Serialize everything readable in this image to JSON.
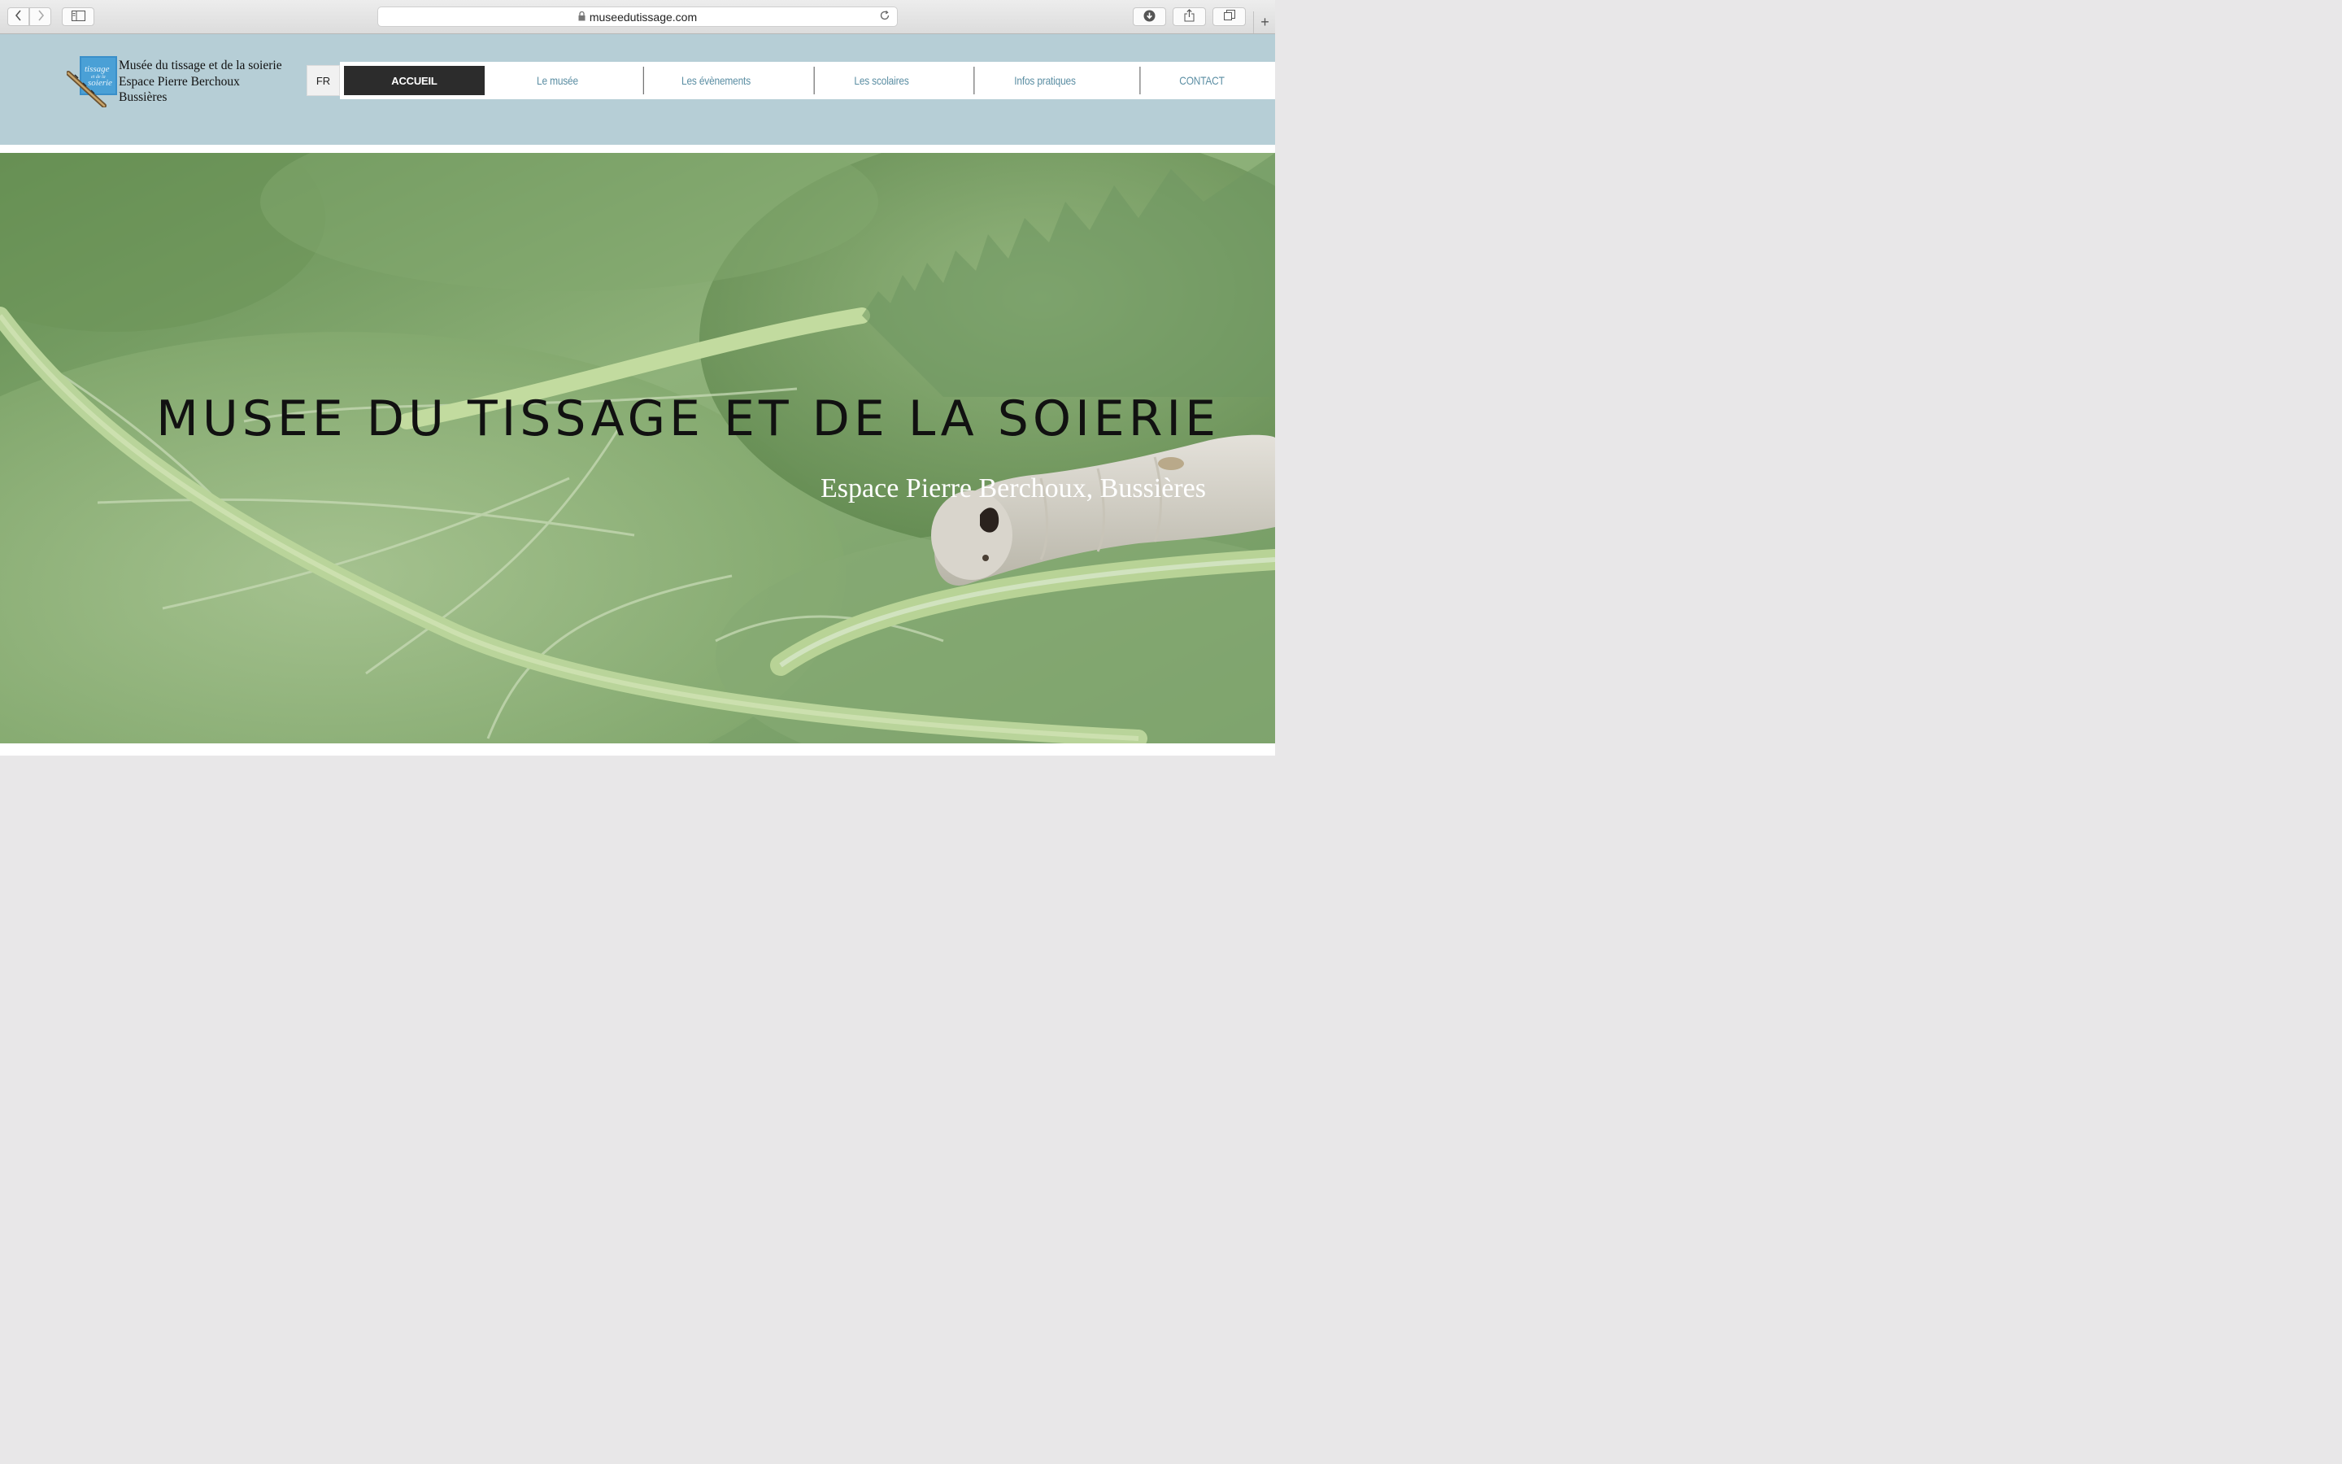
{
  "browser": {
    "url": "museedutissage.com",
    "icons": {
      "back": "chevron-left-icon",
      "forward": "chevron-right-icon",
      "sidebar": "sidebar-icon",
      "lock": "lock-icon",
      "reload": "reload-icon",
      "download": "download-icon",
      "share": "share-icon",
      "tabs": "tabs-icon",
      "new_tab": "plus-icon"
    }
  },
  "header": {
    "brand_line1": "Musée du tissage et de la soierie",
    "brand_line2": "Espace Pierre Berchoux",
    "brand_line3": "Bussières",
    "lang": "FR",
    "nav": [
      {
        "label": "ACCUEIL",
        "active": true
      },
      {
        "label": "Le musée"
      },
      {
        "label": "Les évènements"
      },
      {
        "label": "Les scolaires"
      },
      {
        "label": "Infos pratiques"
      },
      {
        "label": "CONTACT"
      }
    ],
    "colors": {
      "background": "#b6ced6",
      "nav_text": "#5b8ea3",
      "active_bg": "#2c2c2c"
    }
  },
  "hero": {
    "title": "MUSEE DU TISSAGE ET DE LA SOIERIE",
    "subtitle": "Espace Pierre Berchoux, Bussières"
  }
}
